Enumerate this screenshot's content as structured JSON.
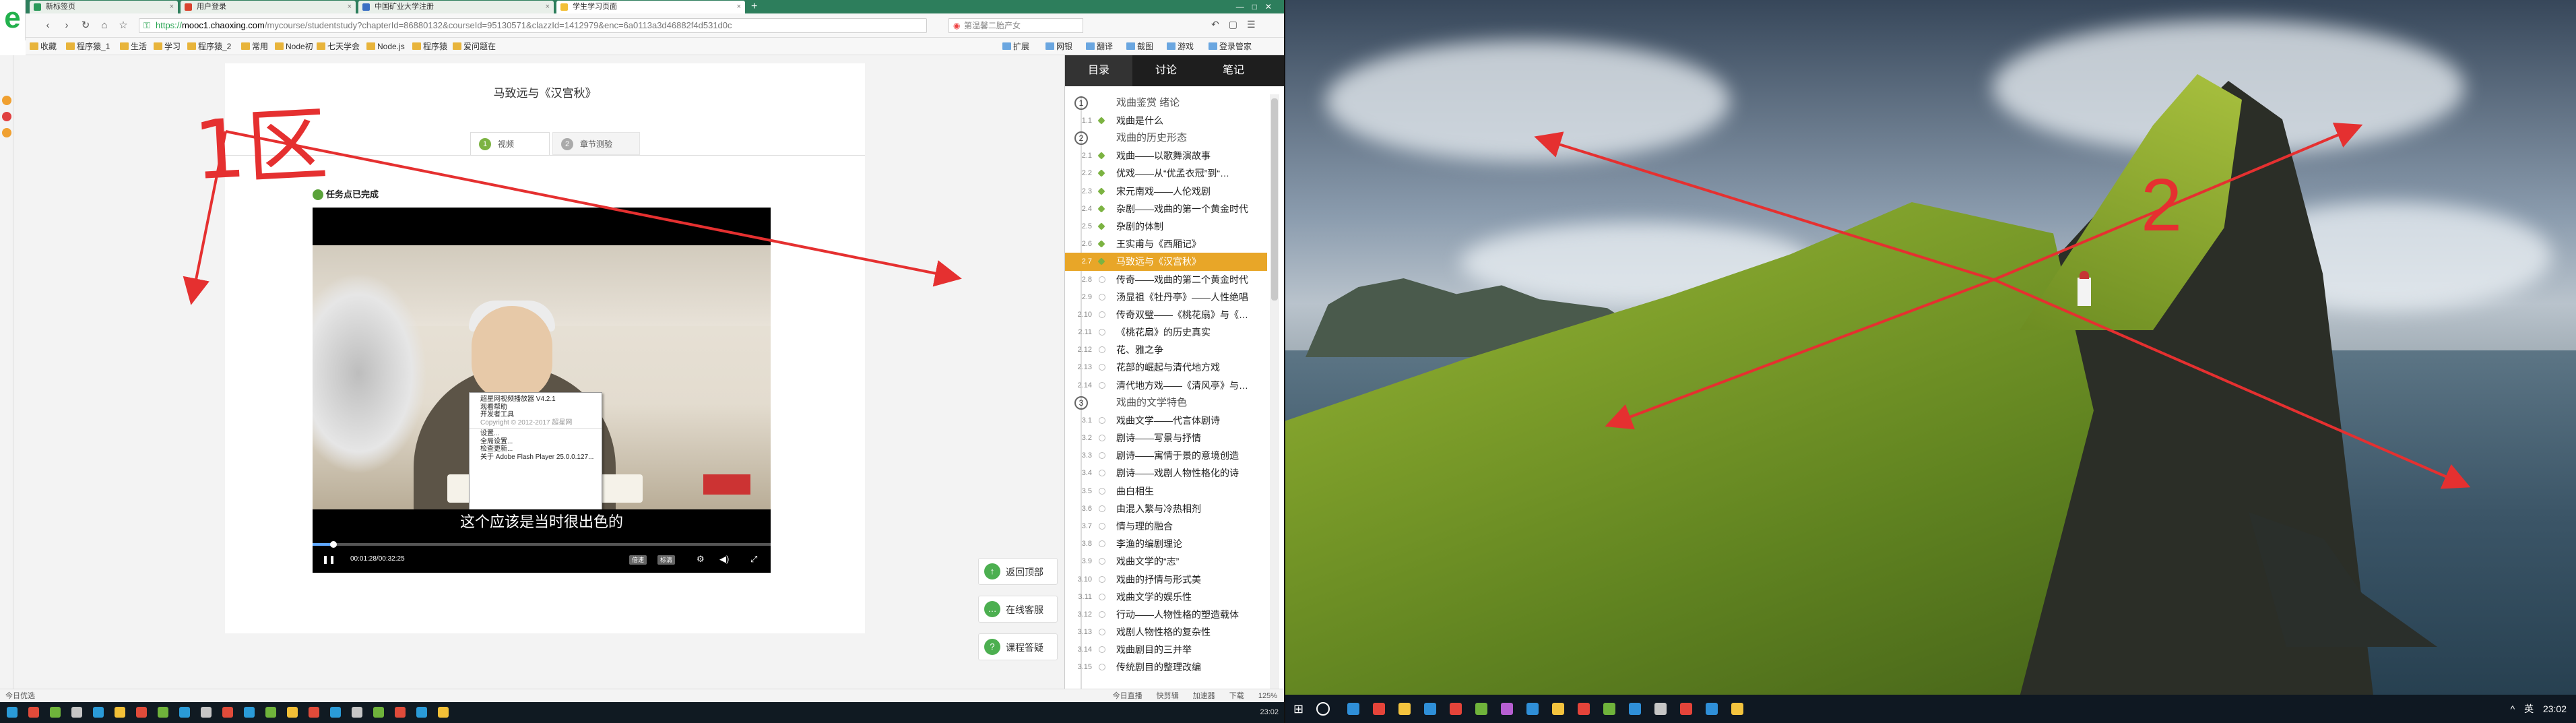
{
  "browser": {
    "tabs": [
      {
        "label": "新标签页",
        "color": "#2b9a5b"
      },
      {
        "label": "用户登录",
        "color": "#d9432f"
      },
      {
        "label": "中国矿业大学注册",
        "color": "#3b6fc4"
      },
      {
        "label": "学生学习页面",
        "color": "#f2c037"
      }
    ],
    "new_tab": "+",
    "url": {
      "scheme": "https://",
      "host": "mooc1.chaoxing.com",
      "path": "/mycourse/studentstudy?chapterId=86880132&courseId=95130571&clazzId=1412979&enc=6a0113a3d46882f4d531d0c"
    },
    "search_placeholder": "第温馨二胎产女",
    "bookmarks": [
      "收藏",
      "程序猿_1",
      "生活",
      "学习",
      "程序猿_2",
      "常用",
      "Node初",
      "七天学会",
      "Node.js",
      "程序猿",
      "爱问题在",
      "扩展",
      "网银",
      "翻译",
      "截图",
      "游戏",
      "登录管家"
    ]
  },
  "page": {
    "course_title": "马致远与《汉宫秋》",
    "tabs": [
      {
        "n": "1",
        "label": "视频"
      },
      {
        "n": "2",
        "label": "章节测验"
      }
    ],
    "task_status": "任务点已完成",
    "subtitle": "这个应该是当时很出色的",
    "player": {
      "time": "00:01:28/00:32:25",
      "btn_a": "倍速",
      "btn_b": "标清",
      "progress": 0.045,
      "context_menu": [
        "超星网视频播放器 V4.2.1",
        "观看帮助",
        "开发者工具",
        "Copyright © 2012-2017 超星网",
        "设置...",
        "全局设置...",
        "检查更新...",
        "关于 Adobe Flash Player 25.0.0.127..."
      ]
    },
    "side_buttons": [
      {
        "icon": "↑",
        "label": "返回顶部"
      },
      {
        "icon": "…",
        "label": "在线客服"
      },
      {
        "icon": "?",
        "label": "课程答疑"
      }
    ],
    "annotation_1": "1区",
    "annotation_2": "2"
  },
  "panel": {
    "tabs": [
      "目录",
      "讨论",
      "笔记"
    ],
    "sections": [
      {
        "n": "1",
        "title": "戏曲鉴赏 绪论",
        "items": [
          {
            "num": "1.1",
            "title": "戏曲是什么",
            "state": "done"
          }
        ]
      },
      {
        "n": "2",
        "title": "戏曲的历史形态",
        "items": [
          {
            "num": "2.1",
            "title": "戏曲——以歌舞演故事",
            "state": "done"
          },
          {
            "num": "2.2",
            "title": "优戏——从“优孟衣冠”到“…",
            "state": "done"
          },
          {
            "num": "2.3",
            "title": "宋元南戏——人伦戏剧",
            "state": "done"
          },
          {
            "num": "2.4",
            "title": "杂剧——戏曲的第一个黄金时代",
            "state": "done"
          },
          {
            "num": "2.5",
            "title": "杂剧的体制",
            "state": "done"
          },
          {
            "num": "2.6",
            "title": "王实甫与《西厢记》",
            "state": "done"
          },
          {
            "num": "2.7",
            "title": "马致远与《汉宫秋》",
            "state": "current"
          },
          {
            "num": "2.8",
            "title": "传奇——戏曲的第二个黄金时代",
            "state": "todo"
          },
          {
            "num": "2.9",
            "title": "汤显祖《牡丹亭》——人性绝唱",
            "state": "todo"
          },
          {
            "num": "2.10",
            "title": "传奇双璧——《桃花扇》与《…",
            "state": "todo"
          },
          {
            "num": "2.11",
            "title": "《桃花扇》的历史真实",
            "state": "todo"
          },
          {
            "num": "2.12",
            "title": "花、雅之争",
            "state": "todo"
          },
          {
            "num": "2.13",
            "title": "花部的崛起与清代地方戏",
            "state": "todo"
          },
          {
            "num": "2.14",
            "title": "清代地方戏——《清风亭》与…",
            "state": "todo"
          }
        ]
      },
      {
        "n": "3",
        "title": "戏曲的文学特色",
        "items": [
          {
            "num": "3.1",
            "title": "戏曲文学——代言体剧诗",
            "state": "todo"
          },
          {
            "num": "3.2",
            "title": "剧诗——写景与抒情",
            "state": "todo"
          },
          {
            "num": "3.3",
            "title": "剧诗——寓情于景的意境创造",
            "state": "todo"
          },
          {
            "num": "3.4",
            "title": "剧诗——戏剧人物性格化的诗",
            "state": "todo"
          },
          {
            "num": "3.5",
            "title": "曲白相生",
            "state": "todo"
          },
          {
            "num": "3.6",
            "title": "由混入繁与冷热相剂",
            "state": "todo"
          },
          {
            "num": "3.7",
            "title": "情与理的融合",
            "state": "todo"
          },
          {
            "num": "3.8",
            "title": "李渔的编剧理论",
            "state": "todo"
          },
          {
            "num": "3.9",
            "title": "戏曲文学的“志”",
            "state": "todo"
          },
          {
            "num": "3.10",
            "title": "戏曲的抒情与形式美",
            "state": "todo"
          },
          {
            "num": "3.11",
            "title": "戏曲文学的娱乐性",
            "state": "todo"
          },
          {
            "num": "3.12",
            "title": "行动——人物性格的塑造载体",
            "state": "todo"
          },
          {
            "num": "3.13",
            "title": "戏剧人物性格的复杂性",
            "state": "todo"
          },
          {
            "num": "3.14",
            "title": "戏曲剧目的三并举",
            "state": "todo"
          },
          {
            "num": "3.15",
            "title": "传统剧目的整理改编",
            "state": "todo"
          }
        ]
      }
    ]
  },
  "statusbar": {
    "left": "今日优选",
    "right": [
      "今日直播",
      "快剪辑",
      "加速器",
      "下载",
      "125%"
    ]
  },
  "taskbar1": {
    "time": "23:02"
  },
  "taskbar2": {
    "tray": [
      "^",
      "英",
      "23:02"
    ]
  },
  "colors": {
    "accent_green": "#7cb342",
    "current_lesson": "#e8a628",
    "annotation_red": "#e53030"
  }
}
